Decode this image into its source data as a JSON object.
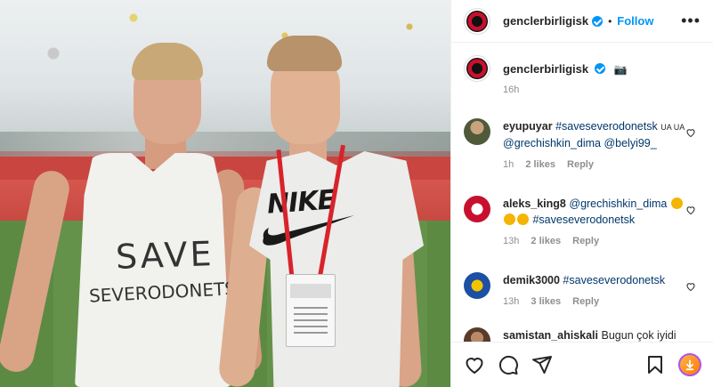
{
  "post": {
    "username": "genclerbirligisk",
    "follow_label": "Follow",
    "dot": "•",
    "more_label": "•••",
    "caption_emoji": "📷",
    "caption_time": "16h"
  },
  "media": {
    "shirt_line1": "SAVE",
    "shirt_line2": "SEVERODONETSK",
    "shirt_brand": "NIKE"
  },
  "comments": [
    {
      "username": "eyupuyar",
      "hashtag": "#saveseverodonetsk",
      "flags": "UA UA",
      "mention1": "@grechishkin_dima",
      "mention2": "@belyi99_",
      "time": "1h",
      "likes": "2 likes",
      "reply": "Reply"
    },
    {
      "username": "aleks_king8",
      "mention1": "@grechishkin_dima",
      "hashtag": "#saveseverodonetsk",
      "time": "13h",
      "likes": "2 likes",
      "reply": "Reply"
    },
    {
      "username": "demik3000",
      "hashtag": "#saveseverodonetsk",
      "time": "13h",
      "likes": "3 likes",
      "reply": "Reply"
    },
    {
      "username": "samistan_ahiskali",
      "text": "Bugun çok iyidi"
    }
  ],
  "colors": {
    "accent": "#0095f6",
    "link": "#00376b",
    "muted": "#8e8e8e"
  },
  "icons": [
    "heart-icon",
    "comment-icon",
    "share-icon",
    "bookmark-icon",
    "verified-icon",
    "more-icon",
    "camera-emoji"
  ]
}
